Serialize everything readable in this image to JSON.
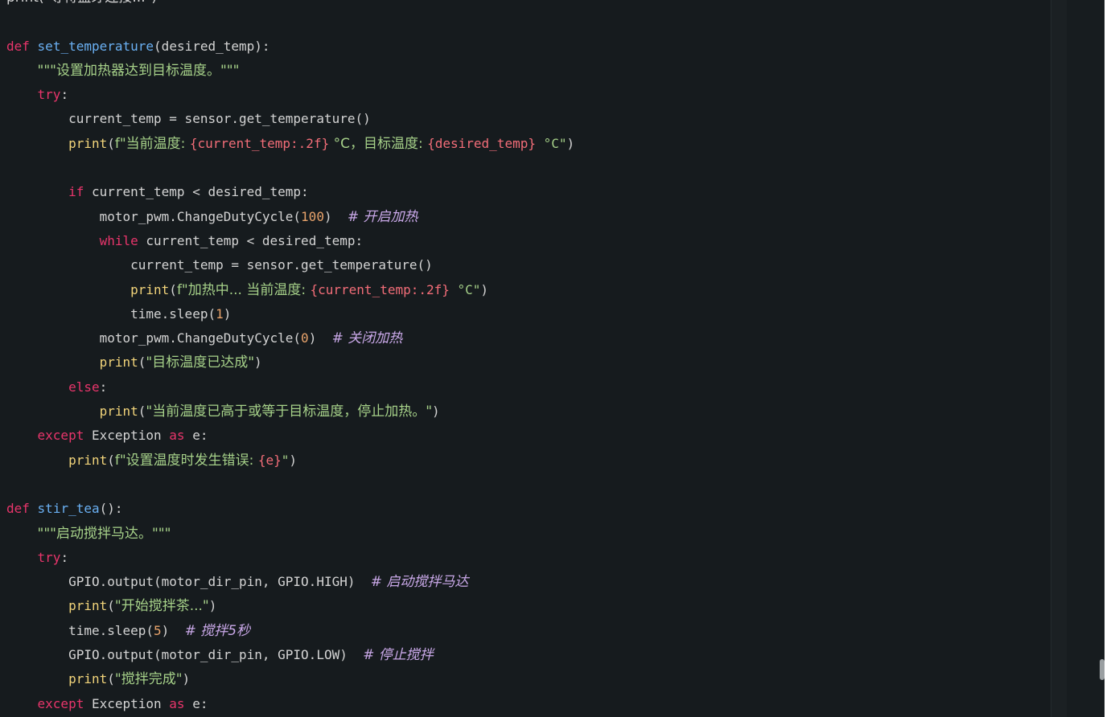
{
  "colors": {
    "background": "#161b1e",
    "keyword": "#e8356b",
    "function_name": "#6ab0f3",
    "builtin": "#f2d47a",
    "string": "#a6d189",
    "number": "#e8a36b",
    "fstring_expr": "#f26d78",
    "comment": "#c9a8e8",
    "plain": "#d4d4d4"
  },
  "code_lines": [
    [
      {
        "t": "print(\"等待蓝牙连接...\")",
        "c": "plain",
        "zh": true
      }
    ],
    [],
    [
      {
        "t": "def",
        "c": "keyword"
      },
      {
        "t": " "
      },
      {
        "t": "set_temperature",
        "c": "function_name"
      },
      {
        "t": "(desired_temp):"
      }
    ],
    [
      {
        "t": "    "
      },
      {
        "t": "\"\"\"设置加热器达到目标温度。\"\"\"",
        "c": "string",
        "zh": true
      }
    ],
    [
      {
        "t": "    "
      },
      {
        "t": "try",
        "c": "keyword"
      },
      {
        "t": ":"
      }
    ],
    [
      {
        "t": "        current_temp = sensor.get_temperature()"
      }
    ],
    [
      {
        "t": "        "
      },
      {
        "t": "print",
        "c": "builtin"
      },
      {
        "t": "("
      },
      {
        "t": "f\"当前温度: ",
        "c": "string",
        "zh": true
      },
      {
        "t": "{current_temp:.2f}",
        "c": "fstring_expr"
      },
      {
        "t": " °C，目标温度: ",
        "c": "string",
        "zh": true
      },
      {
        "t": "{desired_temp}",
        "c": "fstring_expr"
      },
      {
        "t": " °C\"",
        "c": "string"
      },
      {
        "t": ")"
      }
    ],
    [],
    [
      {
        "t": "        "
      },
      {
        "t": "if",
        "c": "keyword"
      },
      {
        "t": " current_temp < desired_temp:"
      }
    ],
    [
      {
        "t": "            motor_pwm.ChangeDutyCycle("
      },
      {
        "t": "100",
        "c": "number"
      },
      {
        "t": ")  "
      },
      {
        "t": "# 开启加热",
        "c": "comment",
        "zh": true
      }
    ],
    [
      {
        "t": "            "
      },
      {
        "t": "while",
        "c": "keyword"
      },
      {
        "t": " current_temp < desired_temp:"
      }
    ],
    [
      {
        "t": "                current_temp = sensor.get_temperature()"
      }
    ],
    [
      {
        "t": "                "
      },
      {
        "t": "print",
        "c": "builtin"
      },
      {
        "t": "("
      },
      {
        "t": "f\"加热中... 当前温度: ",
        "c": "string",
        "zh": true
      },
      {
        "t": "{current_temp:.2f}",
        "c": "fstring_expr"
      },
      {
        "t": " °C\"",
        "c": "string"
      },
      {
        "t": ")"
      }
    ],
    [
      {
        "t": "                time.sleep("
      },
      {
        "t": "1",
        "c": "number"
      },
      {
        "t": ")"
      }
    ],
    [
      {
        "t": "            motor_pwm.ChangeDutyCycle("
      },
      {
        "t": "0",
        "c": "number"
      },
      {
        "t": ")  "
      },
      {
        "t": "# 关闭加热",
        "c": "comment",
        "zh": true
      }
    ],
    [
      {
        "t": "            "
      },
      {
        "t": "print",
        "c": "builtin"
      },
      {
        "t": "("
      },
      {
        "t": "\"目标温度已达成\"",
        "c": "string",
        "zh": true
      },
      {
        "t": ")"
      }
    ],
    [
      {
        "t": "        "
      },
      {
        "t": "else",
        "c": "keyword"
      },
      {
        "t": ":"
      }
    ],
    [
      {
        "t": "            "
      },
      {
        "t": "print",
        "c": "builtin"
      },
      {
        "t": "("
      },
      {
        "t": "\"当前温度已高于或等于目标温度，停止加热。\"",
        "c": "string",
        "zh": true
      },
      {
        "t": ")"
      }
    ],
    [
      {
        "t": "    "
      },
      {
        "t": "except",
        "c": "keyword"
      },
      {
        "t": " Exception "
      },
      {
        "t": "as",
        "c": "keyword"
      },
      {
        "t": " e:"
      }
    ],
    [
      {
        "t": "        "
      },
      {
        "t": "print",
        "c": "builtin"
      },
      {
        "t": "("
      },
      {
        "t": "f\"设置温度时发生错误: ",
        "c": "string",
        "zh": true
      },
      {
        "t": "{e}",
        "c": "fstring_expr"
      },
      {
        "t": "\"",
        "c": "string"
      },
      {
        "t": ")"
      }
    ],
    [],
    [
      {
        "t": "def",
        "c": "keyword"
      },
      {
        "t": " "
      },
      {
        "t": "stir_tea",
        "c": "function_name"
      },
      {
        "t": "():"
      }
    ],
    [
      {
        "t": "    "
      },
      {
        "t": "\"\"\"启动搅拌马达。\"\"\"",
        "c": "string",
        "zh": true
      }
    ],
    [
      {
        "t": "    "
      },
      {
        "t": "try",
        "c": "keyword"
      },
      {
        "t": ":"
      }
    ],
    [
      {
        "t": "        GPIO.output(motor_dir_pin, GPIO.HIGH)  "
      },
      {
        "t": "# 启动搅拌马达",
        "c": "comment",
        "zh": true
      }
    ],
    [
      {
        "t": "        "
      },
      {
        "t": "print",
        "c": "builtin"
      },
      {
        "t": "("
      },
      {
        "t": "\"开始搅拌茶...\"",
        "c": "string",
        "zh": true
      },
      {
        "t": ")"
      }
    ],
    [
      {
        "t": "        time.sleep("
      },
      {
        "t": "5",
        "c": "number"
      },
      {
        "t": ")  "
      },
      {
        "t": "# 搅拌5秒",
        "c": "comment",
        "zh": true
      }
    ],
    [
      {
        "t": "        GPIO.output(motor_dir_pin, GPIO.LOW)  "
      },
      {
        "t": "# 停止搅拌",
        "c": "comment",
        "zh": true
      }
    ],
    [
      {
        "t": "        "
      },
      {
        "t": "print",
        "c": "builtin"
      },
      {
        "t": "("
      },
      {
        "t": "\"搅拌完成\"",
        "c": "string",
        "zh": true
      },
      {
        "t": ")"
      }
    ],
    [
      {
        "t": "    "
      },
      {
        "t": "except",
        "c": "keyword"
      },
      {
        "t": " Exception "
      },
      {
        "t": "as",
        "c": "keyword"
      },
      {
        "t": " e:"
      }
    ]
  ]
}
